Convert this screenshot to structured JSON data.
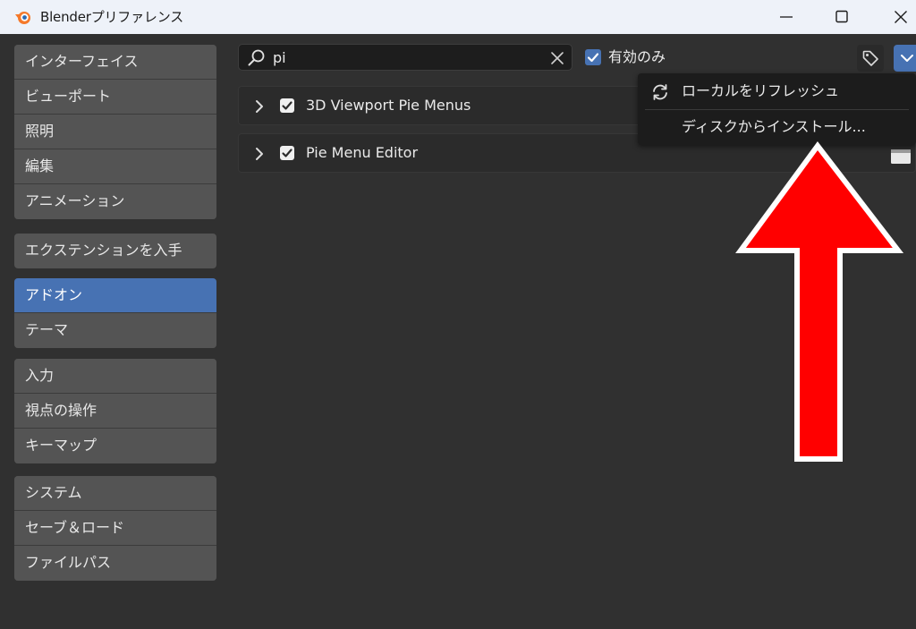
{
  "window": {
    "title": "Blenderプリファレンス",
    "logo_icon": "blender-logo-icon",
    "controls": [
      "minimize-icon",
      "maximize-icon",
      "close-icon"
    ]
  },
  "sidebar": {
    "groups": [
      [
        "インターフェイス",
        "ビューポート",
        "照明",
        "編集",
        "アニメーション"
      ],
      [
        "エクステンションを入手"
      ],
      [
        "アドオン",
        "テーマ"
      ],
      [
        "入力",
        "視点の操作",
        "キーマップ"
      ],
      [
        "システム",
        "セーブ＆ロード",
        "ファイルパス"
      ]
    ],
    "active": "アドオン"
  },
  "toolbar": {
    "search_value": "pi",
    "enabled_only_label": "有効のみ",
    "enabled_only_checked": true
  },
  "addons": [
    {
      "name": "3D Viewport Pie Menus",
      "enabled": true
    },
    {
      "name": "Pie Menu Editor",
      "enabled": true
    }
  ],
  "menu": {
    "refresh_label": "ローカルをリフレッシュ",
    "install_label": "ディスクからインストール..."
  },
  "colors": {
    "accent": "#4772b3",
    "arrow": "#ff0000"
  }
}
